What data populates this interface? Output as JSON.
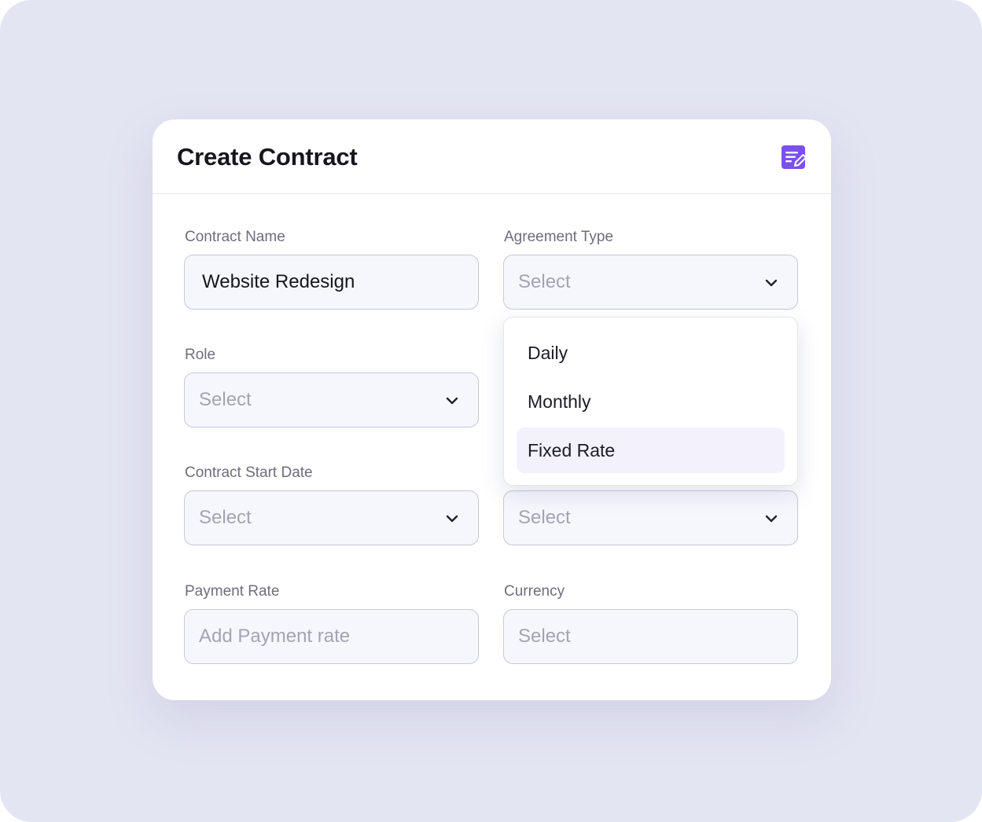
{
  "colors": {
    "accent": "#7b4ff0",
    "background": "#e4e5f2",
    "card": "#ffffff"
  },
  "header": {
    "title": "Create Contract",
    "icon": "edit-note-icon"
  },
  "form": {
    "contract_name": {
      "label": "Contract Name",
      "value": "Website Redesign"
    },
    "agreement_type": {
      "label": "Agreement Type",
      "value": "Select"
    },
    "role": {
      "label": "Role",
      "value": "Select"
    },
    "start_date": {
      "label": "Contract Start Date",
      "value": "Select"
    },
    "end_date": {
      "value": "Select"
    },
    "payment_rate": {
      "label": "Payment Rate",
      "placeholder": "Add Payment rate"
    },
    "currency": {
      "label": "Currency",
      "value": "Select"
    }
  },
  "dropdown": {
    "options": [
      "Daily",
      "Monthly",
      "Fixed Rate"
    ],
    "selected": "Fixed Rate"
  }
}
